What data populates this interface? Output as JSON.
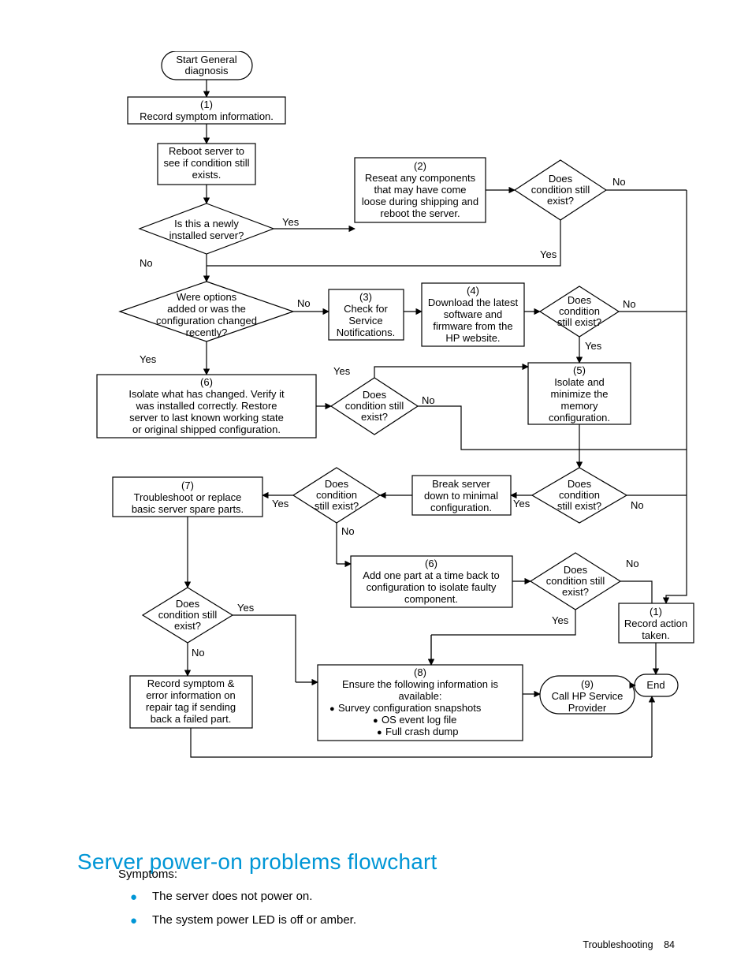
{
  "flowchart": {
    "start": "Start General diagnosis",
    "n1": {
      "num": "(1)",
      "text": "Record symptom information."
    },
    "reboot": "Reboot server to see if condition still exists.",
    "newly": "Is this a newly installed server?",
    "n2": {
      "num": "(2)",
      "text": "Reseat any components that may have come loose during shipping and reboot the server."
    },
    "cond_a": "Does condition still exist?",
    "options": "Were options added or was the configuration changed recently?",
    "n3": {
      "num": "(3)",
      "text": "Check for Service Notifications."
    },
    "n4": {
      "num": "(4)",
      "text": "Download the latest software and firmware from the HP website."
    },
    "cond_b": "Does condition still exist?",
    "n5": {
      "num": "(5)",
      "text": "Isolate and minimize the memory configuration."
    },
    "n6": {
      "num": "(6)",
      "text": "Isolate what has changed. Verify it was installed correctly.  Restore server to last known working state or original shipped configuration."
    },
    "cond_c": "Does condition still exist?",
    "n7": {
      "num": "(7)",
      "text": "Troubleshoot or replace basic server spare parts."
    },
    "cond_d": "Does condition still exist?",
    "break": "Break server down to minimal configuration.",
    "cond_e": "Does condition still exist?",
    "n6b": {
      "num": "(6)",
      "text": "Add one part at a time back to configuration to isolate faulty component."
    },
    "cond_f": "Does condition still exist?",
    "cond_g": "Does condition still exist?",
    "n1b": {
      "num": "(1)",
      "text": "Record action taken."
    },
    "record_tag": "Record symptom & error information on repair tag if sending back a failed part.",
    "n8": {
      "num": "(8)",
      "line1": "Ensure the following information is",
      "line2": "available:",
      "b1": "Survey configuration snapshots",
      "b2": "OS event log file",
      "b3": "Full crash dump"
    },
    "n9": {
      "num": "(9)",
      "text": "Call HP Service Provider"
    },
    "end": "End",
    "yes": "Yes",
    "no": "No"
  },
  "heading": "Server power-on problems flowchart",
  "symptoms_label": "Symptoms:",
  "bullets": [
    "The server does not power on.",
    "The system power LED is off or amber."
  ],
  "footer_section": "Troubleshooting",
  "footer_page": "84"
}
